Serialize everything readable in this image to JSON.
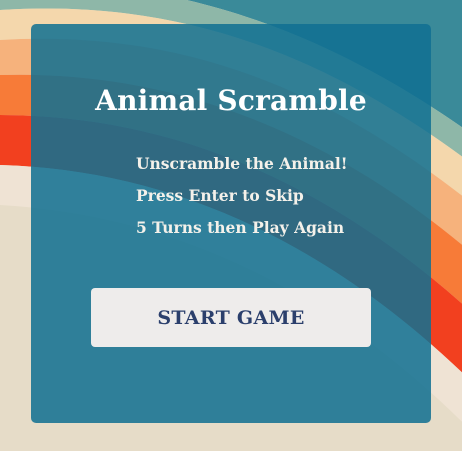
{
  "game": {
    "title": "Animal Scramble",
    "instructions": [
      "Unscramble the Animal!",
      "Press Enter to Skip",
      "5 Turns then Play Again"
    ],
    "start_button_label": "START GAME"
  },
  "colors": {
    "background_cream": "#e6dcc8",
    "card_teal": "#107092",
    "button_bg": "#eeeceb",
    "button_text": "#2b3f6c",
    "band_red": "#f2401f",
    "band_orange": "#f77b38",
    "band_peach": "#f6b27c",
    "band_light_peach": "#f4d7ac",
    "band_sage": "#8eb7a8",
    "band_teal": "#3a8a99"
  }
}
